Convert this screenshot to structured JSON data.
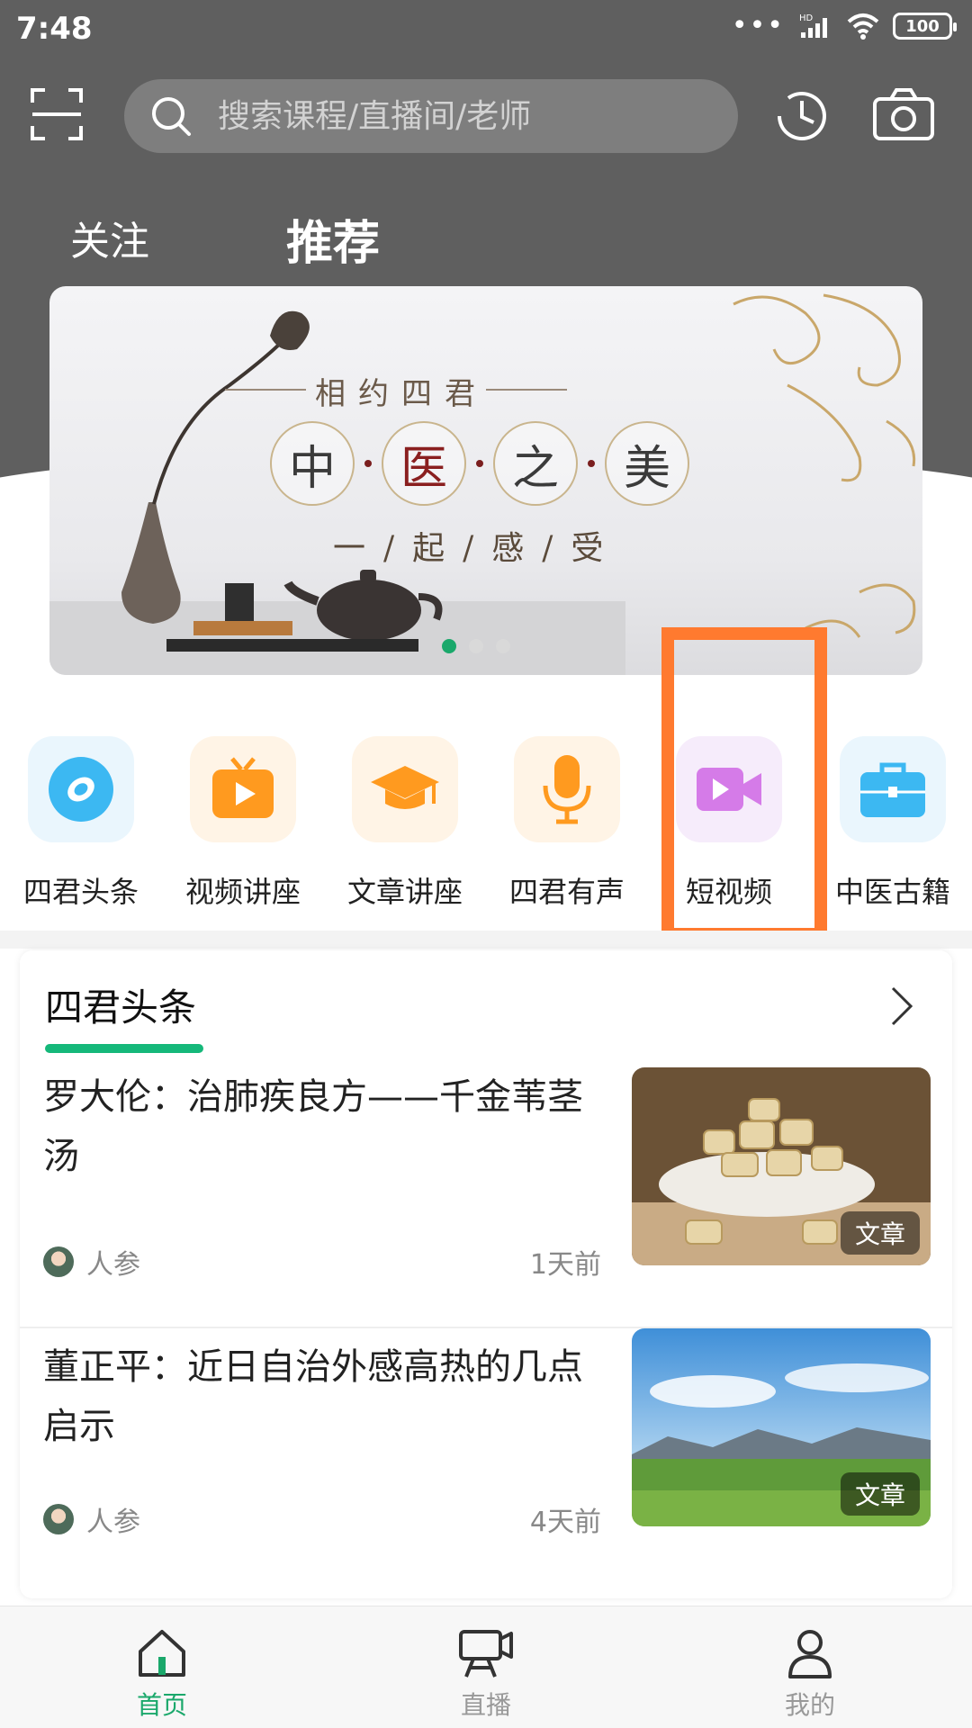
{
  "status_bar": {
    "time": "7:48",
    "battery": "100",
    "network": "HD"
  },
  "search": {
    "placeholder": "搜索课程/直播间/老师"
  },
  "tabs": [
    {
      "label": "关注",
      "active": false
    },
    {
      "label": "推荐",
      "active": true
    }
  ],
  "banner": {
    "caption": "相约四君",
    "characters": [
      "中",
      "医",
      "之",
      "美"
    ],
    "subtitle": "一/起/感/受",
    "page_count": 3,
    "active_page": 1
  },
  "categories": [
    {
      "label": "四君头条",
      "icon": "headline-icon",
      "color": "#3cb8f2",
      "bg": "#eaf6fd"
    },
    {
      "label": "视频讲座",
      "icon": "video-lecture-icon",
      "color": "#ff9a1f",
      "bg": "#fff4e6"
    },
    {
      "label": "文章讲座",
      "icon": "graduation-cap-icon",
      "color": "#ff9a1f",
      "bg": "#fff4e6"
    },
    {
      "label": "四君有声",
      "icon": "microphone-icon",
      "color": "#ff9a1f",
      "bg": "#fff4e6"
    },
    {
      "label": "短视频",
      "icon": "video-camera-icon",
      "color": "#d57be8",
      "bg": "#f6ecfb"
    },
    {
      "label": "中医古籍",
      "icon": "briefcase-icon",
      "color": "#3cb8f2",
      "bg": "#eaf6fd"
    }
  ],
  "feed": {
    "title": "四君头条",
    "articles": [
      {
        "title": "罗大伦：治肺疾良方——千金苇茎汤",
        "author": "人参",
        "time": "1天前",
        "tag": "文章"
      },
      {
        "title": "董正平：近日自治外感高热的几点启示",
        "author": "人参",
        "time": "4天前",
        "tag": "文章"
      }
    ]
  },
  "bottom_nav": [
    {
      "label": "首页",
      "active": true
    },
    {
      "label": "直播",
      "active": false
    },
    {
      "label": "我的",
      "active": false
    }
  ],
  "colors": {
    "accent": "#1aa86b",
    "header": "#5f5f5f",
    "highlight": "#ff7a2f"
  }
}
